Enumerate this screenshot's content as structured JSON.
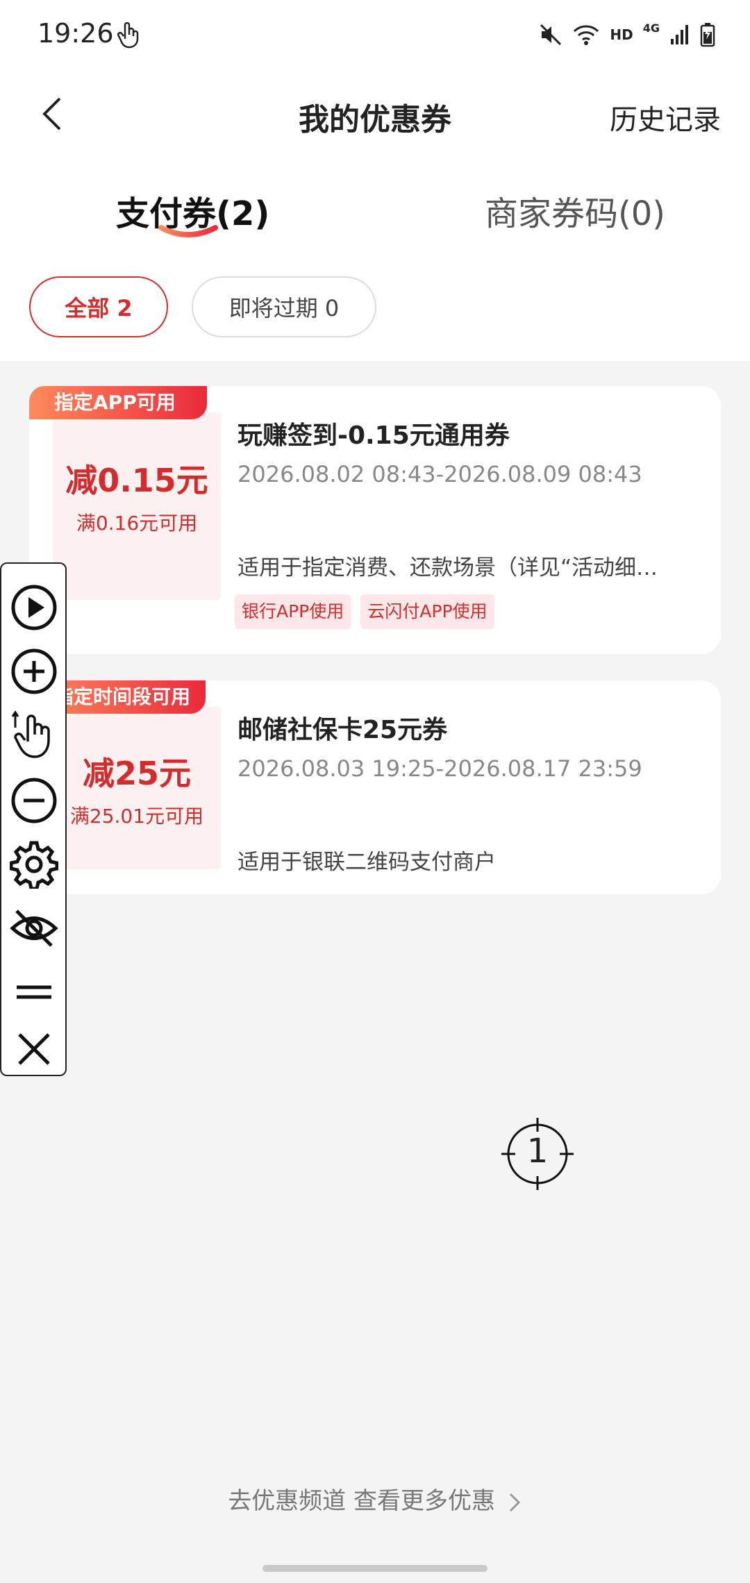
{
  "status_bar": {
    "time": "19:26",
    "hd": "HD",
    "network": "4G",
    "icons": [
      "touch-icon",
      "mute-icon",
      "wifi-icon",
      "signal-icon",
      "battery-icon"
    ]
  },
  "header": {
    "title": "我的优惠券",
    "history": "历史记录",
    "back_icon": "chevron-left-icon"
  },
  "tabs": [
    {
      "label": "支付券(2)",
      "active": true
    },
    {
      "label": "商家券码(0)",
      "active": false
    }
  ],
  "filters": [
    {
      "label": "全部 2",
      "active": true
    },
    {
      "label": "即将过期 0",
      "active": false
    }
  ],
  "coupons": [
    {
      "ribbon": "指定APP可用",
      "amount": "减0.15元",
      "condition": "满0.16元可用",
      "title": "玩赚签到-0.15元通用券",
      "validity": "2026.08.02 08:43-2026.08.09 08:43",
      "description": "适用于指定消费、还款场景（详见“活动细…",
      "tags": [
        "银行APP使用",
        "云闪付APP使用"
      ]
    },
    {
      "ribbon": "指定时间段可用",
      "amount": "减25元",
      "condition": "满25.01元可用",
      "title": "邮储社保卡25元券",
      "validity": "2026.08.03 19:25-2026.08.17 23:59",
      "description": "适用于银联二维码支付商户",
      "tags": []
    }
  ],
  "toolbar": {
    "icons": [
      "play-icon",
      "zoom-in-icon",
      "touch-gesture-icon",
      "zoom-out-icon",
      "settings-icon",
      "eye-off-icon",
      "drag-handle-icon",
      "close-icon"
    ]
  },
  "target": {
    "number": "1"
  },
  "footer": {
    "link": "去优惠频道 查看更多优惠"
  },
  "colors": {
    "accent": "#d42c2c",
    "ribbon_start": "#ff8a5b",
    "ribbon_end": "#ea2a3b",
    "coupon_bg": "#fdf0f0"
  }
}
